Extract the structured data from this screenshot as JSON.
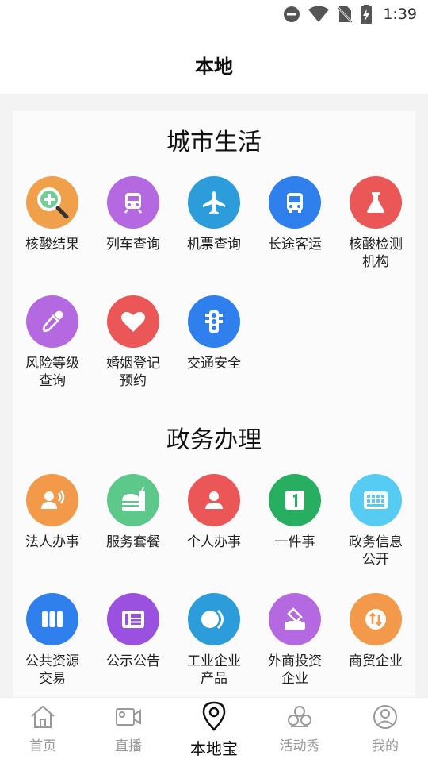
{
  "status_bar": {
    "time": "1:39",
    "icons": [
      "dnd-icon",
      "wifi-icon",
      "no-sim-icon",
      "battery-charging-icon"
    ]
  },
  "header": {
    "title": "本地"
  },
  "sections": [
    {
      "title": "城市生活",
      "items": [
        {
          "label": "核酸结果",
          "icon": "search-plus-icon",
          "color": "#F0A04B"
        },
        {
          "label": "列车查询",
          "icon": "train-icon",
          "color": "#B569E0"
        },
        {
          "label": "机票查询",
          "icon": "airplane-icon",
          "color": "#2D9CDB"
        },
        {
          "label": "长途客运",
          "icon": "bus-icon",
          "color": "#2F80ED"
        },
        {
          "label": "核酸检测\n机构",
          "icon": "flask-icon",
          "color": "#EB5757"
        },
        {
          "label": "风险等级\n查询",
          "icon": "dropper-icon",
          "color": "#B569E0"
        },
        {
          "label": "婚姻登记\n预约",
          "icon": "heart-icon",
          "color": "#EB5757"
        },
        {
          "label": "交通安全",
          "icon": "traffic-light-icon",
          "color": "#2F80ED"
        }
      ]
    },
    {
      "title": "政务办理",
      "items": [
        {
          "label": "法人办事",
          "icon": "person-speak-icon",
          "color": "#F2994A"
        },
        {
          "label": "服务套餐",
          "icon": "meal-icon",
          "color": "#5CC98A"
        },
        {
          "label": "个人办事",
          "icon": "person-card-icon",
          "color": "#EB5757"
        },
        {
          "label": "一件事",
          "icon": "number-one-icon",
          "color": "#27AE60"
        },
        {
          "label": "政务信息\n公开",
          "icon": "grid-icon",
          "color": "#56CCF2"
        },
        {
          "label": "公共资源\n交易",
          "icon": "columns-icon",
          "color": "#2F80ED"
        },
        {
          "label": "公示公告",
          "icon": "newspaper-icon",
          "color": "#9B51E0"
        },
        {
          "label": "工业企业\n产品",
          "icon": "toggle-icon",
          "color": "#2D9CDB"
        },
        {
          "label": "外商投资\n企业",
          "icon": "ballot-icon",
          "color": "#B569E0"
        },
        {
          "label": "商贸企业",
          "icon": "exchange-coin-icon",
          "color": "#F2994A"
        }
      ]
    }
  ],
  "nav": [
    {
      "label": "首页",
      "icon": "home-icon",
      "active": false
    },
    {
      "label": "直播",
      "icon": "video-icon",
      "active": false
    },
    {
      "label": "本地宝",
      "icon": "location-pin-icon",
      "active": true
    },
    {
      "label": "活动秀",
      "icon": "faces-icon",
      "active": false
    },
    {
      "label": "我的",
      "icon": "user-circle-icon",
      "active": false
    }
  ]
}
